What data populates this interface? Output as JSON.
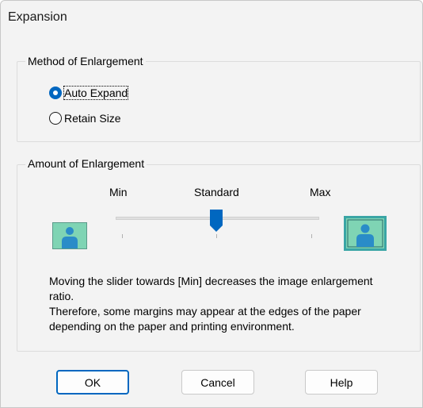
{
  "window": {
    "title": "Expansion"
  },
  "method_group": {
    "label": "Method of Enlargement",
    "options": [
      {
        "label": "Auto Expand",
        "checked": true
      },
      {
        "label": "Retain Size",
        "checked": false
      }
    ]
  },
  "amount_group": {
    "label": "Amount of Enlargement",
    "scale": {
      "min_label": "Min",
      "mid_label": "Standard",
      "max_label": "Max",
      "value": "Standard"
    },
    "description_line1": "Moving the slider towards [Min] decreases the image enlargement ratio.",
    "description_line2": "Therefore, some margins may appear at the edges of the paper depending on the paper and printing environment.",
    "min_icon": "small-image-icon",
    "max_icon": "large-image-icon"
  },
  "buttons": {
    "ok": "OK",
    "cancel": "Cancel",
    "help": "Help"
  },
  "colors": {
    "accent": "#0067c0",
    "thumb": "#0067c0",
    "icon_fill": "#7fd4b4",
    "icon_person": "#2a8cc8",
    "max_icon_border": "#3aa5a5"
  }
}
